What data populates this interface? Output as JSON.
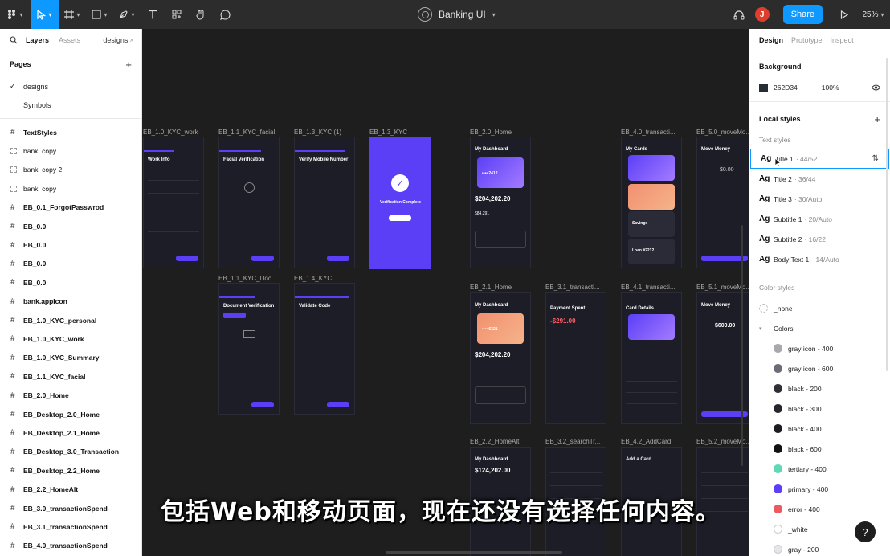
{
  "toolbar": {
    "doc_title": "Banking UI",
    "share_label": "Share",
    "zoom": "25%",
    "user_initial": "J"
  },
  "left_panel": {
    "tabs": [
      "Layers",
      "Assets"
    ],
    "page_selector": "designs",
    "pages_header": "Pages",
    "pages": [
      "designs",
      "Symbols"
    ],
    "layers": [
      {
        "label": "TextStyles",
        "type": "frame"
      },
      {
        "label": "bank. copy",
        "type": "component"
      },
      {
        "label": "bank. copy 2",
        "type": "component"
      },
      {
        "label": "bank. copy",
        "type": "component"
      },
      {
        "label": "EB_0.1_ForgotPasswrod",
        "type": "frame"
      },
      {
        "label": "EB_0.0",
        "type": "frame"
      },
      {
        "label": "EB_0.0",
        "type": "frame"
      },
      {
        "label": "EB_0.0",
        "type": "frame"
      },
      {
        "label": "EB_0.0",
        "type": "frame"
      },
      {
        "label": "bank.appIcon",
        "type": "frame"
      },
      {
        "label": "EB_1.0_KYC_personal",
        "type": "frame"
      },
      {
        "label": "EB_1.0_KYC_work",
        "type": "frame"
      },
      {
        "label": "EB_1.0_KYC_Summary",
        "type": "frame"
      },
      {
        "label": "EB_1.1_KYC_facial",
        "type": "frame"
      },
      {
        "label": "EB_2.0_Home",
        "type": "frame"
      },
      {
        "label": "EB_Desktop_2.0_Home",
        "type": "frame"
      },
      {
        "label": "EB_Desktop_2.1_Home",
        "type": "frame"
      },
      {
        "label": "EB_Desktop_3.0_Transaction",
        "type": "frame"
      },
      {
        "label": "EB_Desktop_2.2_Home",
        "type": "frame"
      },
      {
        "label": "EB_2.2_HomeAlt",
        "type": "frame"
      },
      {
        "label": "EB_3.0_transactionSpend",
        "type": "frame"
      },
      {
        "label": "EB_3.1_transactionSpend",
        "type": "frame"
      },
      {
        "label": "EB_4.0_transactionSpend",
        "type": "frame"
      }
    ]
  },
  "canvas": {
    "frame_labels": {
      "f1": "EB_1.0_KYC_work",
      "f2": "EB_1.1_KYC_facial",
      "f3": "EB_1.3_KYC (1)",
      "f4": "EB_1.3_KYC",
      "f5": "EB_2.0_Home",
      "f6": "EB_4.0_transacti...",
      "f7": "EB_5.0_moveMo...",
      "f8": "EB_1.1_KYC_Doc...",
      "f9": "EB_1.4_KYC",
      "f10": "EB_2.1_Home",
      "f11": "EB_3.1_transacti...",
      "f12": "EB_4.1_transacti...",
      "f13": "EB_5.1_moveMo...",
      "f14": "EB_2.2_HomeAlt",
      "f15": "EB_3.2_searchTr...",
      "f16": "EB_4.2_AddCard",
      "f17": "EB_5.2_moveMo..."
    },
    "screens": {
      "work_info": "Work Info",
      "facial_verification": "Facial Verification",
      "verify_mobile": "Verify Mobile Number",
      "verification_complete": "Verification Complete",
      "my_dashboard": "My Dashboard",
      "balance_1": "$204,202.20",
      "balance_2": "$204,202.20",
      "balance_3": "$124,202.00",
      "card_num_1": "•••• 2412",
      "card_num_2": "•••• 6321",
      "small_1": "$84,291",
      "my_cards": "My Cards",
      "savings": "Savings",
      "loan": "Loan #2212",
      "move_money": "Move Money",
      "amount_1": "$0.00",
      "amount_2": "$600.00",
      "document_verification": "Document Verification",
      "validate_code": "Validate Code",
      "payment_spent": "Payment Spent",
      "spent_amount": "-$291.00",
      "card_details": "Card Details",
      "add_card": "Add a Card"
    },
    "subtitle": "包括Web和移动页面，现在还没有选择任何内容。"
  },
  "right_panel": {
    "tabs": [
      "Design",
      "Prototype",
      "Inspect"
    ],
    "background_title": "Background",
    "bg_color_hex": "262D34",
    "bg_opacity": "100%",
    "local_styles_title": "Local styles",
    "text_styles_header": "Text styles",
    "text_styles": [
      {
        "ag": "Ag",
        "name": "Title 1",
        "meta": "· 44/52"
      },
      {
        "ag": "Ag",
        "name": "Title 2",
        "meta": "· 36/44"
      },
      {
        "ag": "Ag",
        "name": "Title 3",
        "meta": "· 30/Auto"
      },
      {
        "ag": "Ag",
        "name": "Subtitle 1",
        "meta": "· 20/Auto"
      },
      {
        "ag": "Ag",
        "name": "Subtitle 2",
        "meta": "· 16/22"
      },
      {
        "ag": "Ag",
        "name": "Body Text 1",
        "meta": "· 14/Auto"
      }
    ],
    "color_styles_header": "Color styles",
    "none_label": "_none",
    "colors_group": "Colors",
    "colors": [
      {
        "name": "gray icon - 400",
        "hex": "#a8a8ad"
      },
      {
        "name": "gray icon - 600",
        "hex": "#6b6c75"
      },
      {
        "name": "black - 200",
        "hex": "#2f3036"
      },
      {
        "name": "black - 300",
        "hex": "#26272c"
      },
      {
        "name": "black - 400",
        "hex": "#1c1d22"
      },
      {
        "name": "black - 600",
        "hex": "#111114"
      },
      {
        "name": "tertiary - 400",
        "hex": "#5fd8b6"
      },
      {
        "name": "primary - 400",
        "hex": "#5a3ff7"
      },
      {
        "name": "error - 400",
        "hex": "#eb5a5f"
      },
      {
        "name": "_white",
        "hex": "#ffffff"
      },
      {
        "name": "gray - 200",
        "hex": "#e6e6ea"
      }
    ]
  }
}
